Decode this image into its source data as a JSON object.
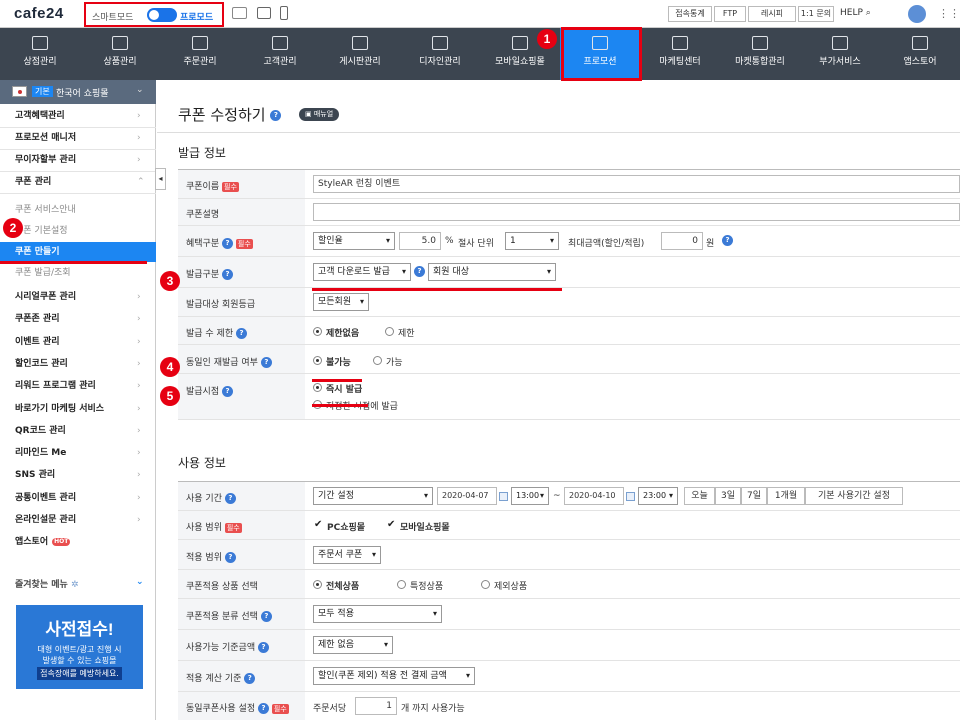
{
  "topbar": {
    "logo": "cafe24",
    "mode_smart": "스마트모드",
    "mode_pro": "프로모드",
    "buttons": [
      "접속통계",
      "FTP",
      "레시피",
      "1:1 문의"
    ],
    "help": "HELP"
  },
  "gnb": {
    "items": [
      {
        "label": "상점관리",
        "icon": "home-icon"
      },
      {
        "label": "상품관리",
        "icon": "shirt-icon"
      },
      {
        "label": "주문관리",
        "icon": "cart-icon"
      },
      {
        "label": "고객관리",
        "icon": "users-icon"
      },
      {
        "label": "게시판관리",
        "icon": "board-icon"
      },
      {
        "label": "디자인관리",
        "icon": "palette-icon"
      },
      {
        "label": "모바일쇼핑몰",
        "icon": "mobile-icon"
      },
      {
        "label": "프로모션",
        "icon": "star-icon",
        "active": true
      },
      {
        "label": "마케팅센터",
        "icon": "monitor-icon"
      },
      {
        "label": "마켓통합관리",
        "icon": "network-icon"
      },
      {
        "label": "부가서비스",
        "icon": "plus-folder-icon"
      },
      {
        "label": "앱스토어",
        "icon": "apps-icon"
      }
    ]
  },
  "badges": [
    "1",
    "2",
    "3",
    "4",
    "5"
  ],
  "sidebar": {
    "shop_tag": "기본",
    "shop_name": "한국어 쇼핑몰",
    "menu1": [
      "고객혜택관리",
      "프로모션 매니저",
      "무이자할부 관리",
      "쿠폰 관리"
    ],
    "sub": [
      "쿠폰 서비스안내",
      "쿠폰 기본설정",
      "쿠폰 만들기",
      "쿠폰 발급/조회"
    ],
    "menu2": [
      "시리얼쿠폰 관리",
      "쿠폰존 관리",
      "이벤트 관리",
      "할인코드 관리",
      "리워드 프로그램 관리",
      "바로가기 마케팅 서비스",
      "QR코드 관리",
      "리마인드 Me",
      "SNS 관리",
      "공통이벤트 관리",
      "온라인설문 관리",
      "앱스토어"
    ],
    "hot": "HOT",
    "favorites": "즐겨찾는 메뉴",
    "banner_title": "사전접수!",
    "banner_line1": "대형 이벤트/광고 진행 시",
    "banner_line2": "발생할 수 있는 쇼핑몰",
    "banner_line3": "접속장애를 예방하세요."
  },
  "page": {
    "title": "쿠폰 수정하기",
    "manual": "매뉴얼",
    "section1": "발급 정보",
    "section2": "사용 정보",
    "required": "필수"
  },
  "issue": {
    "name_label": "쿠폰이름",
    "name_value": "StyleAR 런칭 이벤트",
    "desc_label": "쿠폰설명",
    "benefit_label": "혜택구분",
    "benefit_type": "할인율",
    "benefit_value": "5.0",
    "percent": "%",
    "cut_label": "절사 단위",
    "cut_value": "1",
    "max_label": "최대금액(할인/적립)",
    "max_value": "0",
    "won": "원",
    "kind_label": "발급구분",
    "kind_value": "고객 다운로드 발급",
    "kind_target": "회원 대상",
    "grade_label": "발급대상 회원등급",
    "grade_value": "모든회원",
    "limit_label": "발급 수 제한",
    "limit_opt1": "제한없음",
    "limit_opt2": "제한",
    "reissue_label": "동일인 재발급 여부",
    "reissue_opt1": "불가능",
    "reissue_opt2": "가능",
    "time_label": "발급시점",
    "time_opt1": "즉시 발급",
    "time_opt2": "지정한 시점에 발급"
  },
  "usage": {
    "period_label": "사용 기간",
    "period_type": "기간 설정",
    "start_date": "2020-04-07",
    "start_time": "13:00",
    "tilde": "~",
    "end_date": "2020-04-10",
    "end_time": "23:00",
    "quick": [
      "오늘",
      "3일",
      "7일",
      "1개월",
      "기본 사용기간 설정"
    ],
    "scope_label": "사용 범위",
    "scope_pc": "PC쇼핑몰",
    "scope_mobile": "모바일쇼핑몰",
    "apply_label": "적용 범위",
    "apply_value": "주문서 쿠폰",
    "product_label": "쿠폰적용 상품 선택",
    "product_opts": [
      "전체상품",
      "특정상품",
      "제외상품"
    ],
    "category_label": "쿠폰적용 분류 선택",
    "category_value": "모두 적용",
    "minamount_label": "사용가능 기준금액",
    "minamount_value": "제한 없음",
    "calc_label": "적용 계산 기준",
    "calc_value": "할인(쿠폰 제외) 적용 전 결제 금액",
    "same_label": "동일쿠폰사용 설정",
    "same_prefix": "주문서당",
    "same_value": "1",
    "same_suffix": "개 까지 사용가능"
  },
  "colors": {
    "accent": "#1c86f2",
    "highlight": "#e60012",
    "nav_bg": "#3c4550"
  }
}
